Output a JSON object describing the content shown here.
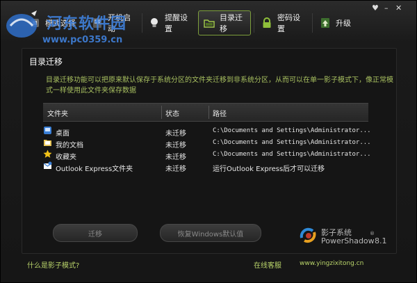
{
  "window": {
    "controls": {
      "menu": "♥",
      "minimize": "–",
      "close": "✕"
    }
  },
  "watermark": {
    "site_name": "河东软件园",
    "url": "www.pc0359.cn"
  },
  "toolbar": {
    "items": [
      {
        "label": "模式选择",
        "icon": "mode-icon",
        "active": false
      },
      {
        "label": "开机启动",
        "icon": "power-on-icon",
        "active": false
      },
      {
        "label": "提醒设置",
        "icon": "bulb-icon",
        "active": false
      },
      {
        "label": "目录迁移",
        "icon": "folder-icon",
        "active": true
      },
      {
        "label": "密码设置",
        "icon": "lock-icon",
        "active": false
      },
      {
        "label": "升级",
        "icon": "upgrade-icon",
        "active": false
      }
    ]
  },
  "panel": {
    "title": "目录迁移",
    "description": "目录迁移功能可以把原来默认保存于系统分区的文件夹迁移到非系统分区，从而可以在单一影子模式下，像正常模式一样使用此文件夹保存数据"
  },
  "table": {
    "headers": {
      "folder": "文件夹",
      "status": "状态",
      "path": "路径"
    },
    "rows": [
      {
        "icon": "desktop-icon",
        "folder": "桌面",
        "status": "未迁移",
        "path": "C:\\Documents and Settings\\Administrator..."
      },
      {
        "icon": "documents-icon",
        "folder": "我的文档",
        "status": "未迁移",
        "path": "C:\\Documents and Settings\\Administrator..."
      },
      {
        "icon": "star-icon",
        "folder": "收藏夹",
        "status": "未迁移",
        "path": "C:\\Documents and Settings\\Administrator..."
      },
      {
        "icon": "outlook-icon",
        "folder": "Outlook Express文件夹",
        "status": "未迁移",
        "path": "运行Outlook Express后才可以迁移"
      }
    ]
  },
  "buttons": {
    "migrate": "迁移",
    "restore": "恢复Windows默认值"
  },
  "brand": {
    "name_cn": "影子系统",
    "name_en": "PowerShadow",
    "registered": "®",
    "version": "8.1"
  },
  "footer": {
    "help_link": "什么是影子模式?",
    "support_link": "在线客服",
    "website": "www.yingzixitong.cn"
  },
  "colors": {
    "accent_green": "#b9d46a",
    "description_green": "#a8c060",
    "watermark_blue": "#3f7fd8"
  }
}
